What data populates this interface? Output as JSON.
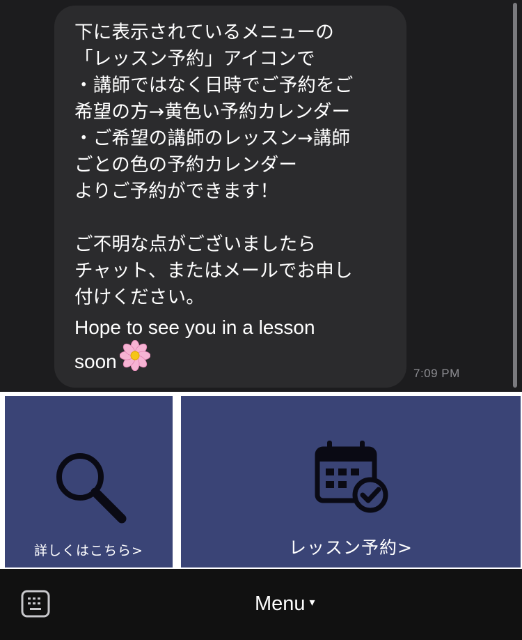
{
  "message": {
    "lines": [
      "下に表示されているメニューの",
      "「レッスン予約」アイコンで",
      "・講師ではなく日時でご予約をご",
      "希望の方→黄色い予約カレンダー",
      "・ご希望の講師のレッスン→講師",
      "ごとの色の予約カレンダー",
      "よりご予約ができます！",
      "",
      "ご不明な点がございましたら",
      "チャット、またはメールでお申し",
      "付けください。",
      "Hope to see you in a lesson",
      "soon"
    ],
    "emoji": "flower-emoji",
    "timestamp": "7:09 PM"
  },
  "rich_menu": {
    "left_tile": {
      "label": "詳しくはこちら>",
      "icon": "search-icon"
    },
    "right_tile": {
      "label": "レッスン予約>",
      "icon": "calendar-check-icon"
    }
  },
  "bottom_bar": {
    "keyboard_icon": "keyboard-icon",
    "menu_label": "Menu",
    "menu_caret": "▾"
  },
  "colors": {
    "background": "#1c1c1e",
    "bubble": "#2b2b2d",
    "tile": "#3a4476",
    "bar": "#111111"
  }
}
